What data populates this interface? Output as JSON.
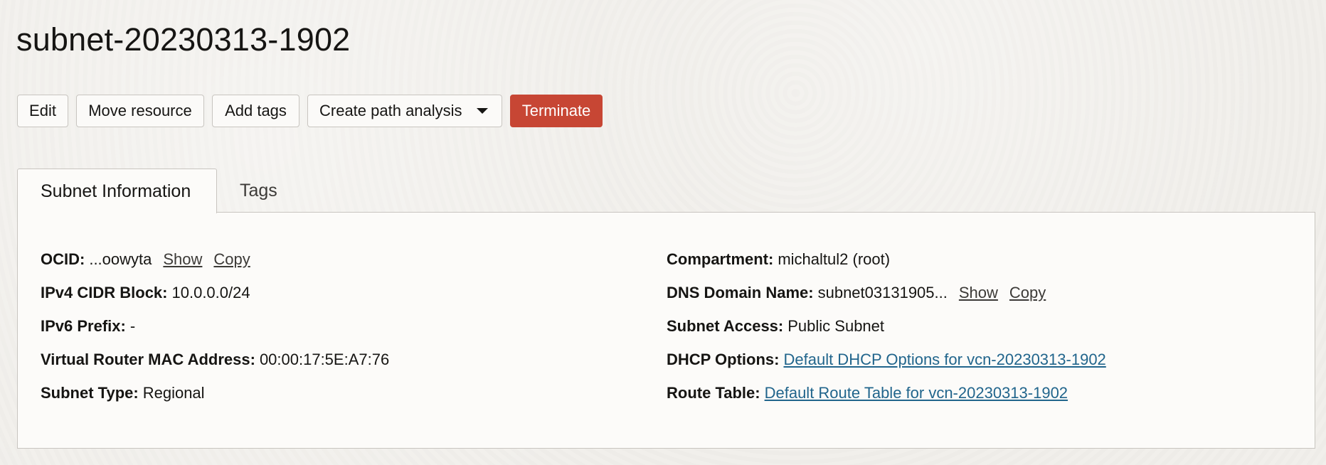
{
  "page": {
    "title": "subnet-20230313-1902"
  },
  "toolbar": {
    "edit_label": "Edit",
    "move_label": "Move resource",
    "add_tags_label": "Add tags",
    "path_analysis_label": "Create path analysis",
    "terminate_label": "Terminate"
  },
  "tabs": [
    {
      "label": "Subnet Information",
      "active": true
    },
    {
      "label": "Tags",
      "active": false
    }
  ],
  "info": {
    "ocid": {
      "label": "OCID:",
      "value": "...oowyta",
      "show": "Show",
      "copy": "Copy"
    },
    "ipv4": {
      "label": "IPv4 CIDR Block:",
      "value": "10.0.0.0/24"
    },
    "ipv6": {
      "label": "IPv6 Prefix:",
      "value": "-"
    },
    "mac": {
      "label": "Virtual Router MAC Address:",
      "value": "00:00:17:5E:A7:76"
    },
    "subnet_type": {
      "label": "Subnet Type:",
      "value": "Regional"
    },
    "compartment": {
      "label": "Compartment:",
      "value": "michaltul2 (root)"
    },
    "dns": {
      "label": "DNS Domain Name:",
      "value": "subnet03131905...",
      "show": "Show",
      "copy": "Copy"
    },
    "access": {
      "label": "Subnet Access:",
      "value": "Public Subnet"
    },
    "dhcp": {
      "label": "DHCP Options:",
      "value": "Default DHCP Options for vcn-20230313-1902"
    },
    "route": {
      "label": "Route Table:",
      "value": "Default Route Table for vcn-20230313-1902"
    }
  },
  "colors": {
    "danger": "#c74634",
    "link": "#21658c",
    "background": "#f1efeb",
    "panel": "#fcfbf9"
  },
  "icons": {
    "dropdown": "chevron-down-icon"
  }
}
